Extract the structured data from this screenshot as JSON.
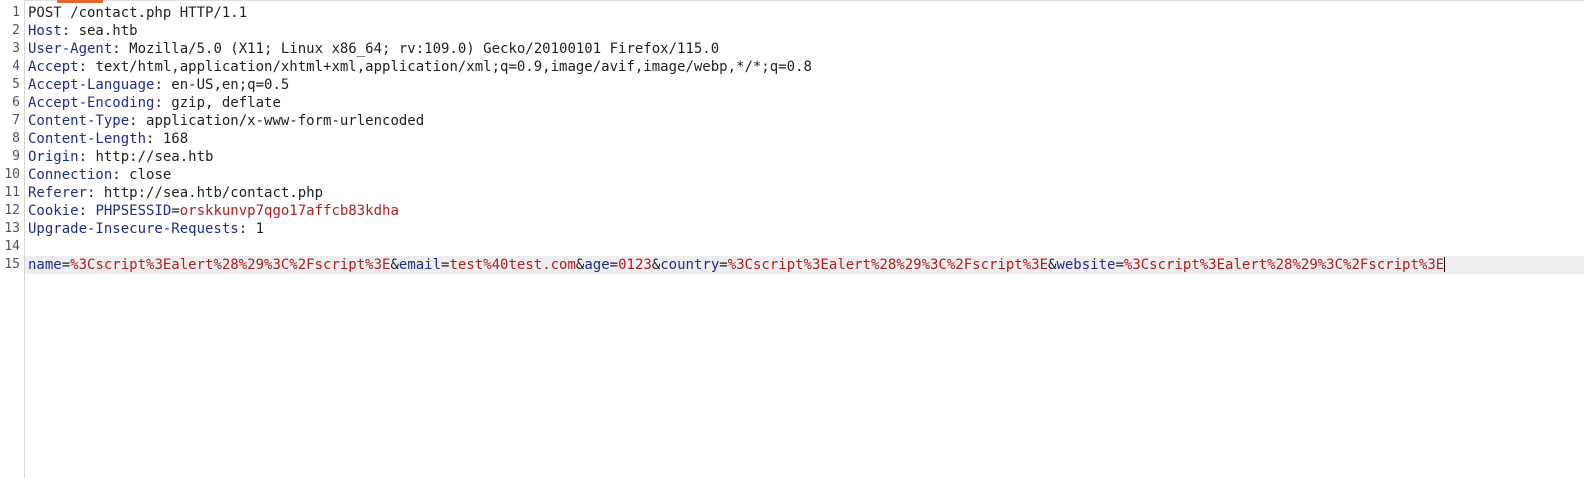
{
  "request_line": "POST /contact.php HTTP/1.1",
  "line_numbers": [
    "1",
    "2",
    "3",
    "4",
    "5",
    "6",
    "7",
    "8",
    "9",
    "10",
    "11",
    "12",
    "13",
    "14",
    "15"
  ],
  "headers": [
    {
      "name": "Host",
      "value": "sea.htb"
    },
    {
      "name": "User-Agent",
      "value": "Mozilla/5.0 (X11; Linux x86_64; rv:109.0) Gecko/20100101 Firefox/115.0"
    },
    {
      "name": "Accept",
      "value": "text/html,application/xhtml+xml,application/xml;q=0.9,image/avif,image/webp,*/*;q=0.8"
    },
    {
      "name": "Accept-Language",
      "value": "en-US,en;q=0.5"
    },
    {
      "name": "Accept-Encoding",
      "value": "gzip, deflate"
    },
    {
      "name": "Content-Type",
      "value": "application/x-www-form-urlencoded"
    },
    {
      "name": "Content-Length",
      "value": "168"
    },
    {
      "name": "Origin",
      "value": "http://sea.htb"
    },
    {
      "name": "Connection",
      "value": "close"
    },
    {
      "name": "Referer",
      "value": "http://sea.htb/contact.php"
    }
  ],
  "cookie": {
    "name": "Cookie",
    "key": "PHPSESSID",
    "value": "orskkunvp7qgo17affcb83kdha"
  },
  "upgrade": {
    "name": "Upgrade-Insecure-Requests",
    "value": "1"
  },
  "body_params": [
    {
      "key": "name",
      "value": "%3Cscript%3Ealert%28%29%3C%2Fscript%3E"
    },
    {
      "key": "email",
      "value": "test%40test.com"
    },
    {
      "key": "age",
      "value": "0123"
    },
    {
      "key": "country",
      "value": "%3Cscript%3Ealert%28%29%3C%2Fscript%3E"
    },
    {
      "key": "website",
      "value": "%3Cscript%3Ealert%28%29%3C%2Fscript%3E"
    }
  ],
  "syntax_colors": {
    "header_name": "#1f2d8c",
    "param_value": "#b02020",
    "active_line_bg": "#eeeeee",
    "tab_accent": "#e8622c"
  }
}
